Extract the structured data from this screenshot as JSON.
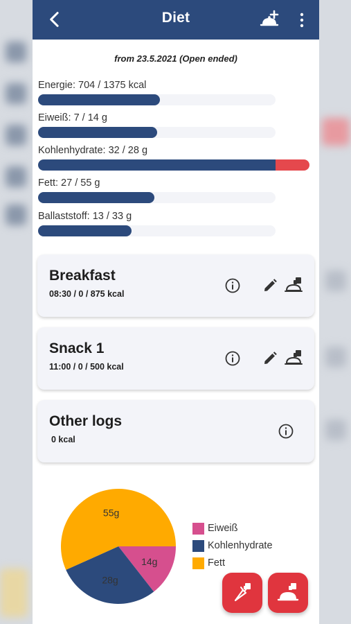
{
  "app": {
    "title": "Diet"
  },
  "period": "from 23.5.2021 (Open ended)",
  "nutrients": [
    {
      "label": "Energie: 704 / 1375 kcal",
      "fraction": 0.512,
      "over_fraction": 0
    },
    {
      "label": "Eiweiß: 7 / 14 g",
      "fraction": 0.5,
      "over_fraction": 0
    },
    {
      "label": "Kohlenhydrate: 32 / 28 g",
      "fraction": 1.0,
      "over_fraction": 0.143
    },
    {
      "label": "Fett: 27 / 55 g",
      "fraction": 0.491,
      "over_fraction": 0
    },
    {
      "label": "Ballaststoff: 13 / 33 g",
      "fraction": 0.394,
      "over_fraction": 0
    }
  ],
  "meals": [
    {
      "name": "Breakfast",
      "sub": "08:30 /  0 / 875 kcal"
    },
    {
      "name": "Snack 1",
      "sub": "11:00 /  0 / 500 kcal"
    },
    {
      "name": "Other logs",
      "sub": "0 kcal"
    }
  ],
  "colors": {
    "primary": "#2c4a7c",
    "over": "#e5484d",
    "fab": "#e0353e",
    "eiweiss": "#d64f8e",
    "kohlenhydrate": "#2c4a7c",
    "fett": "#ffaa00"
  },
  "icons": {
    "back": "arrow-back-icon",
    "add_meal": "add-meal-icon",
    "more": "more-vert-icon",
    "info": "info-icon",
    "edit": "pencil-icon",
    "log_meal": "log-meal-icon",
    "fab_left": "carrot-log-icon",
    "fab_right": "meal-log-icon"
  },
  "chart_data": {
    "type": "pie",
    "labels": [
      "Eiweiß",
      "Kohlenhydrate",
      "Fett"
    ],
    "values": [
      14,
      28,
      55
    ],
    "slice_labels": [
      "14g",
      "28g",
      "55g"
    ],
    "colors": [
      "#d64f8e",
      "#2c4a7c",
      "#ffaa00"
    ],
    "legend": "right"
  }
}
